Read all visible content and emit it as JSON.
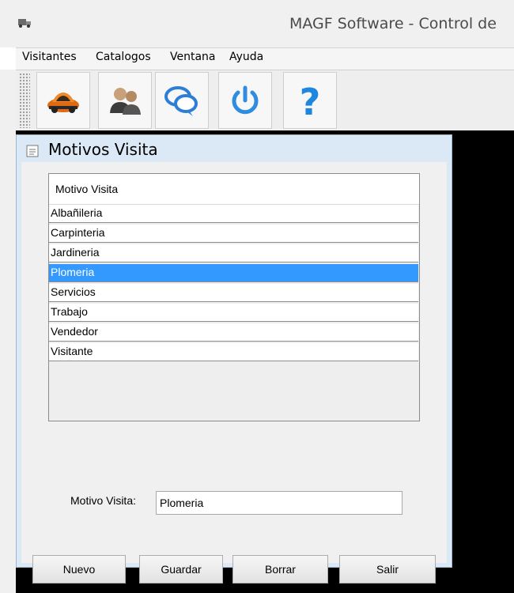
{
  "window": {
    "title": "MAGF Software - Control de",
    "app_icon": "truck-icon"
  },
  "menubar": {
    "items": [
      "Visitantes",
      "Catalogos",
      "Ventana",
      "Ayuda"
    ]
  },
  "toolbar": {
    "buttons": [
      {
        "icon": "car-icon"
      },
      {
        "icon": "users-icon"
      },
      {
        "icon": "chat-bubbles-icon"
      },
      {
        "icon": "power-icon"
      },
      {
        "icon": "help-question-icon"
      }
    ]
  },
  "internal_frame": {
    "title": "Motivos Visita",
    "icon": "document-icon"
  },
  "table": {
    "header": "Motivo Visita",
    "rows": [
      "Albañileria",
      "Carpinteria",
      "Jardineria",
      "Plomeria",
      "Servicios",
      "Trabajo",
      "Vendedor",
      "Visitante"
    ],
    "selected": "Plomeria"
  },
  "form": {
    "label": "Motivo Visita:",
    "value": "Plomeria"
  },
  "buttons": {
    "nuevo": "Nuevo",
    "guardar": "Guardar",
    "borrar": "Borrar",
    "salir": "Salir"
  },
  "colors": {
    "selection": "#3399ff",
    "frame_border": "#dbe8f6",
    "desktop": "#000000"
  }
}
